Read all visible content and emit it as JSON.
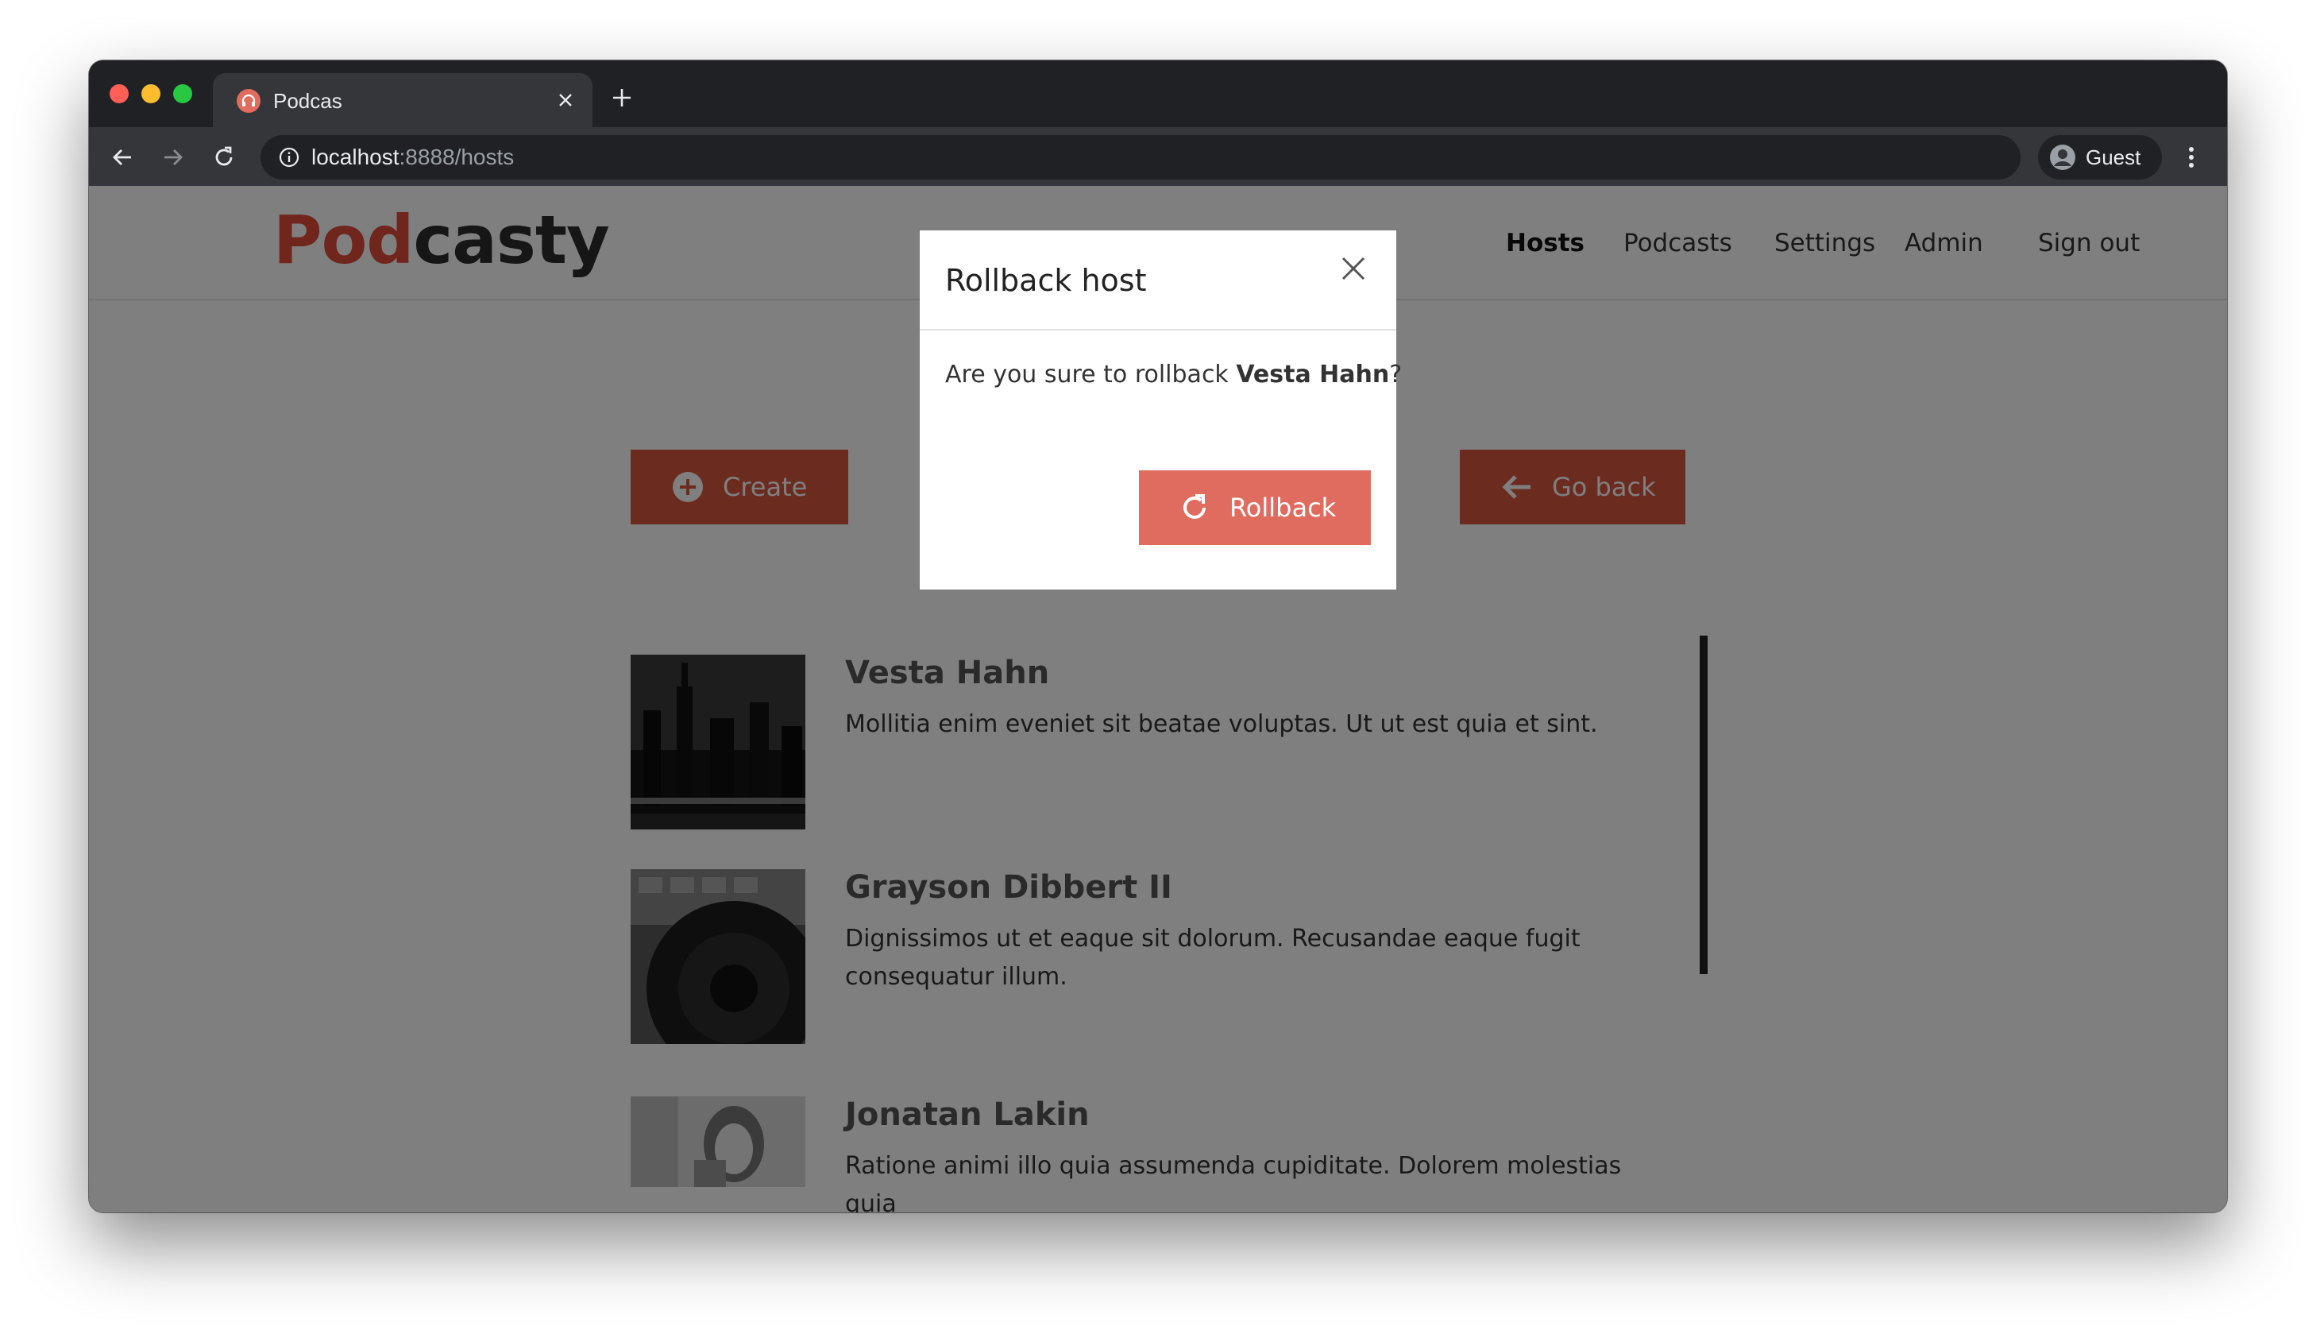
{
  "browser": {
    "tab_title": "Podcas",
    "url_host": "localhost",
    "url_rest": ":8888/hosts",
    "profile_name": "Guest"
  },
  "site": {
    "logo_part1": "Pod",
    "logo_part2": "casty",
    "nav": [
      {
        "label": "Hosts",
        "active": true
      },
      {
        "label": "Podcasts"
      },
      {
        "label": "Settings"
      },
      {
        "label": "Admin"
      },
      {
        "label": "Sign out"
      }
    ]
  },
  "actions": {
    "create_label": "Create",
    "go_back_label": "Go back"
  },
  "hosts": [
    {
      "name": "Vesta Hahn",
      "description": "Mollitia enim eveniet sit beatae voluptas. Ut ut est quia et sint."
    },
    {
      "name": "Grayson Dibbert II",
      "description": "Dignissimos ut et eaque sit dolorum. Recusandae eaque fugit consequatur illum."
    },
    {
      "name": "Jonatan Lakin",
      "description": "Ratione animi illo quia assumenda cupiditate. Dolorem molestias quia"
    }
  ],
  "modal": {
    "title": "Rollback host",
    "body_prefix": "Are you sure to rollback ",
    "body_name": "Vesta Hahn",
    "body_suffix": "?",
    "confirm_label": "Rollback"
  },
  "colors": {
    "brand": "#e04a3b",
    "button": "#d9563f",
    "modal_button": "#e06c5f"
  },
  "icons": {
    "tab_favicon": "headphones-icon",
    "create": "plus-circle-icon",
    "go_back": "arrow-left-icon",
    "rollback": "rotate-cw-icon",
    "modal_close": "close-icon"
  }
}
